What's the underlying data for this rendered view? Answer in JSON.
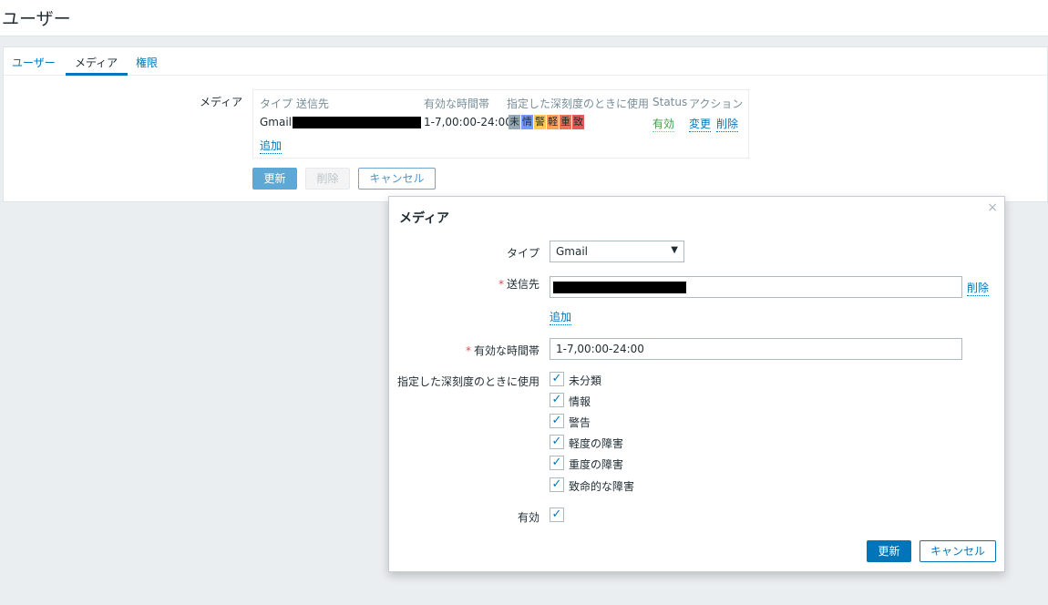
{
  "page": {
    "title": "ユーザー"
  },
  "tabs": [
    {
      "label": "ユーザー"
    },
    {
      "label": "メディア"
    },
    {
      "label": "権限"
    }
  ],
  "media_section": {
    "label": "メディア",
    "headers": {
      "type": "タイプ",
      "sendto": "送信先",
      "when": "有効な時間帯",
      "severity": "指定した深刻度のときに使用",
      "status": "Status",
      "action": "アクション"
    },
    "row": {
      "type": "Gmail",
      "when": "1-7,00:00-24:00",
      "severity_badges": [
        {
          "label": "未",
          "color": "#97aab3"
        },
        {
          "label": "情",
          "color": "#7499ff"
        },
        {
          "label": "警",
          "color": "#ffc859"
        },
        {
          "label": "軽",
          "color": "#ffa059"
        },
        {
          "label": "重",
          "color": "#e97659"
        },
        {
          "label": "致",
          "color": "#e45959"
        }
      ],
      "status": "有効",
      "edit": "変更",
      "delete": "削除"
    },
    "add": "追加"
  },
  "form_buttons": {
    "update": "更新",
    "delete": "削除",
    "cancel": "キャンセル"
  },
  "dialog": {
    "title": "メディア",
    "close": "×",
    "type_label": "タイプ",
    "type_value": "Gmail",
    "sendto_label": "送信先",
    "sendto_delete": "削除",
    "sendto_add": "追加",
    "when_label": "有効な時間帯",
    "when_value": "1-7,00:00-24:00",
    "severity_label": "指定した深刻度のときに使用",
    "severities": [
      {
        "label": "未分類",
        "checked": true
      },
      {
        "label": "情報",
        "checked": true
      },
      {
        "label": "警告",
        "checked": true
      },
      {
        "label": "軽度の障害",
        "checked": true
      },
      {
        "label": "重度の障害",
        "checked": true
      },
      {
        "label": "致命的な障害",
        "checked": true
      }
    ],
    "enabled_label": "有効",
    "enabled_checked": true,
    "update": "更新",
    "cancel": "キャンセル",
    "check_mark": "✓"
  },
  "colors": {
    "accent": "#0275b8",
    "status_enabled": "#429e47",
    "required": "#d64e4e"
  }
}
